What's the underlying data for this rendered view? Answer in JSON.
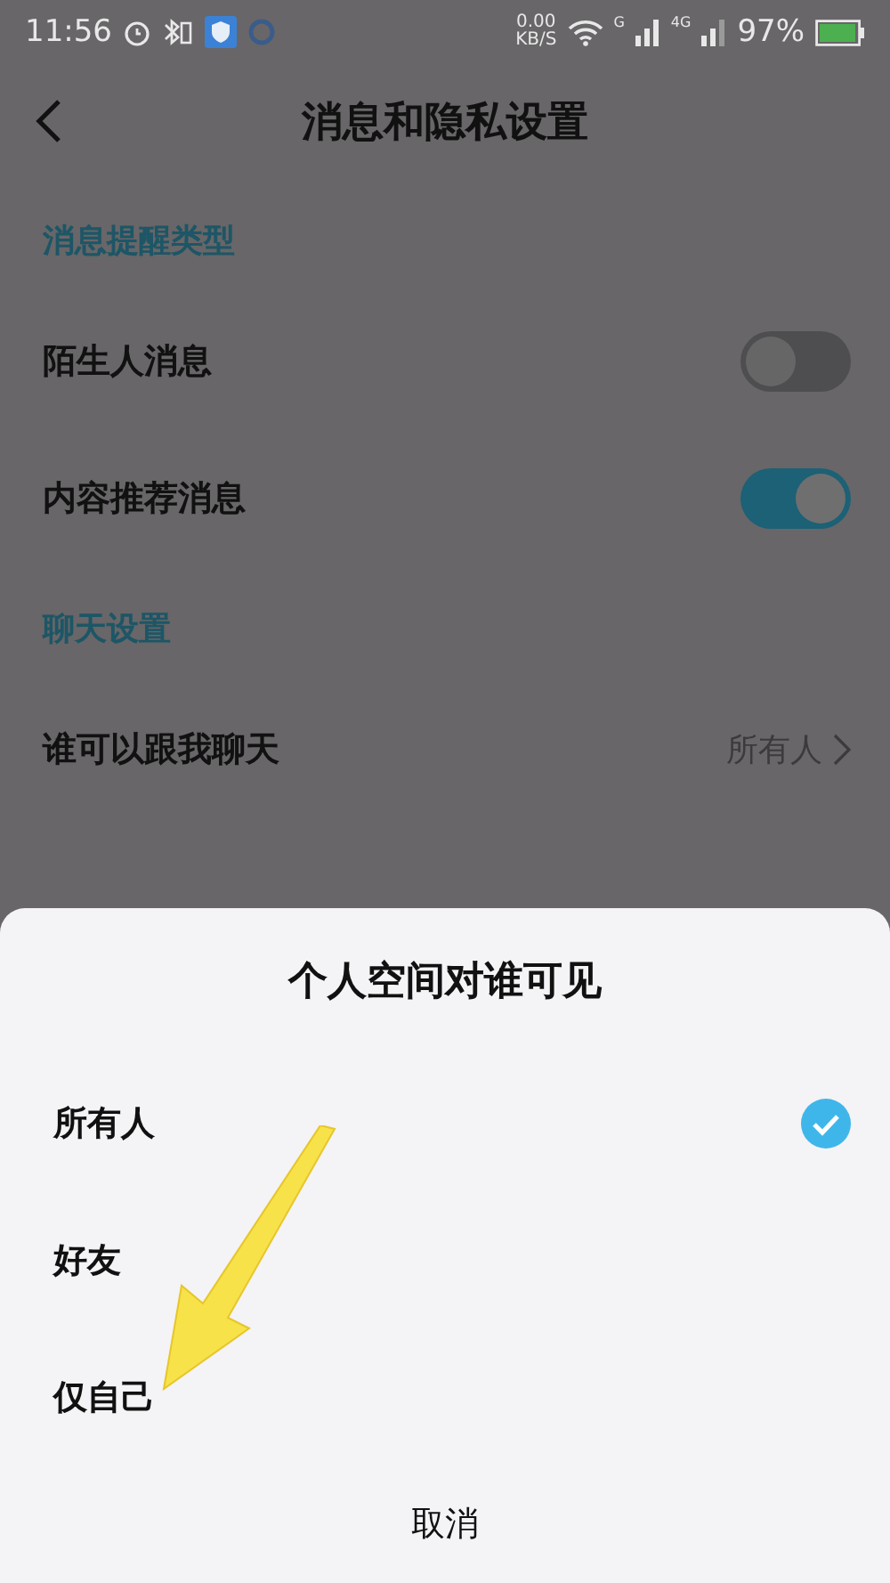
{
  "status_bar": {
    "time": "11:56",
    "speed": "0.00",
    "speed_unit": "KB/S",
    "sim_1": "G",
    "sim_2": "4G",
    "battery": "97%"
  },
  "header": {
    "title": "消息和隐私设置"
  },
  "sections": [
    {
      "title": "消息提醒类型",
      "items": [
        {
          "kind": "toggle",
          "label": "陌生人消息",
          "on": false
        },
        {
          "kind": "toggle",
          "label": "内容推荐消息",
          "on": true
        }
      ]
    },
    {
      "title": "聊天设置",
      "items": [
        {
          "kind": "link",
          "label": "谁可以跟我聊天",
          "value": "所有人"
        }
      ]
    }
  ],
  "sheet": {
    "title": "个人空间对谁可见",
    "options": [
      {
        "label": "所有人",
        "selected": true
      },
      {
        "label": "好友",
        "selected": false
      },
      {
        "label": "仅自己",
        "selected": false
      }
    ],
    "cancel": "取消"
  }
}
